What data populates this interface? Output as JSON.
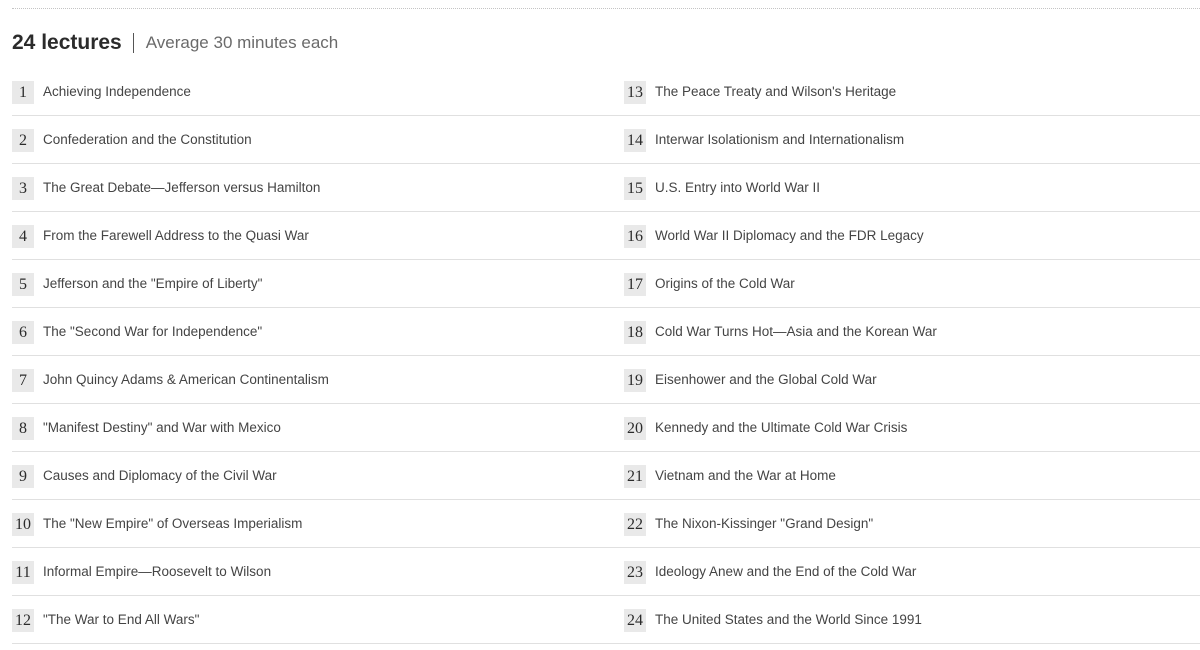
{
  "header": {
    "count_label": "24 lectures",
    "average_label": "Average 30 minutes each"
  },
  "lectures": [
    {
      "number": "1",
      "title": "Achieving Independence"
    },
    {
      "number": "2",
      "title": "Confederation and the Constitution"
    },
    {
      "number": "3",
      "title": "The Great Debate—Jefferson versus Hamilton"
    },
    {
      "number": "4",
      "title": "From the Farewell Address to the Quasi War"
    },
    {
      "number": "5",
      "title": "Jefferson and the \"Empire of Liberty\""
    },
    {
      "number": "6",
      "title": "The \"Second War for Independence\""
    },
    {
      "number": "7",
      "title": "John Quincy Adams & American Continentalism"
    },
    {
      "number": "8",
      "title": "\"Manifest Destiny\" and War with Mexico"
    },
    {
      "number": "9",
      "title": "Causes and Diplomacy of the Civil War"
    },
    {
      "number": "10",
      "title": "The \"New Empire\" of Overseas Imperialism"
    },
    {
      "number": "11",
      "title": "Informal Empire—Roosevelt to Wilson"
    },
    {
      "number": "12",
      "title": "\"The War to End All Wars\""
    },
    {
      "number": "13",
      "title": "The Peace Treaty and Wilson's Heritage"
    },
    {
      "number": "14",
      "title": "Interwar Isolationism and Internationalism"
    },
    {
      "number": "15",
      "title": "U.S. Entry into World War II"
    },
    {
      "number": "16",
      "title": "World War II Diplomacy and the FDR Legacy"
    },
    {
      "number": "17",
      "title": "Origins of the Cold War"
    },
    {
      "number": "18",
      "title": "Cold War Turns Hot—Asia and the Korean War"
    },
    {
      "number": "19",
      "title": "Eisenhower and the Global Cold War"
    },
    {
      "number": "20",
      "title": "Kennedy and the Ultimate Cold War Crisis"
    },
    {
      "number": "21",
      "title": "Vietnam and the War at Home"
    },
    {
      "number": "22",
      "title": "The Nixon-Kissinger \"Grand Design\""
    },
    {
      "number": "23",
      "title": "Ideology Anew and the End of the Cold War"
    },
    {
      "number": "24",
      "title": "The United States and the World Since 1991"
    }
  ]
}
